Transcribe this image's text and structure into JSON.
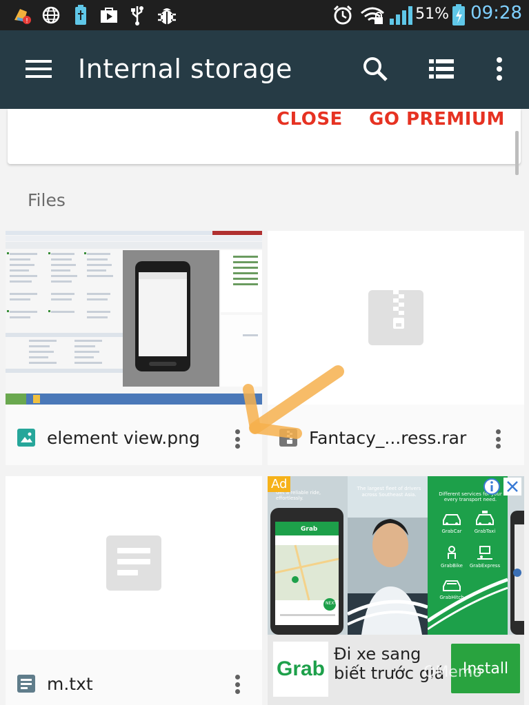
{
  "status_bar": {
    "battery_percent": "51%",
    "time": "09:28",
    "left_icons": [
      "cleaner-alert-icon",
      "globe-icon",
      "usb-battery-icon",
      "play-store-icon",
      "usb-icon",
      "bug-icon"
    ],
    "right_icons": [
      "alarm-icon",
      "wifi-icon",
      "signal-icon",
      "battery-charging-icon"
    ]
  },
  "app_bar": {
    "title": "Internal storage",
    "icons": [
      "menu-icon",
      "search-icon",
      "list-view-icon",
      "overflow-menu-icon"
    ]
  },
  "banner": {
    "close_label": "CLOSE",
    "premium_label": "GO PREMIUM"
  },
  "files_section": {
    "label": "Files"
  },
  "files": [
    {
      "name": "element view.png",
      "type": "image",
      "icon": "image-file-icon"
    },
    {
      "name": "Fantacy_...ress.rar",
      "type": "archive",
      "icon": "archive-file-icon"
    },
    {
      "name": "m.txt",
      "type": "text",
      "icon": "text-file-icon"
    }
  ],
  "ad": {
    "badge": "Ad",
    "headline_line1": "Đi xe sang",
    "headline_line2": "biết trước giá",
    "install_label": "Install",
    "logo_text": "Grab",
    "panel2_caption": "The largest fleet of drivers across Southeast Asia.",
    "panel1_caption": "Get a reliable ride, effortlessly.",
    "panel3_caption": "Different services for your every transport need.",
    "services": [
      "GrabCar",
      "GrabTaxi",
      "GrabBike",
      "GrabExpress",
      "GrabHitch"
    ],
    "phone_app_title": "Grab",
    "phone_button": "NEXT"
  },
  "watermark": "QMemo",
  "colors": {
    "app_bar": "#263b45",
    "accent_red": "#e63222",
    "grab_green": "#29a33f",
    "clock_blue": "#7fd0ff"
  }
}
